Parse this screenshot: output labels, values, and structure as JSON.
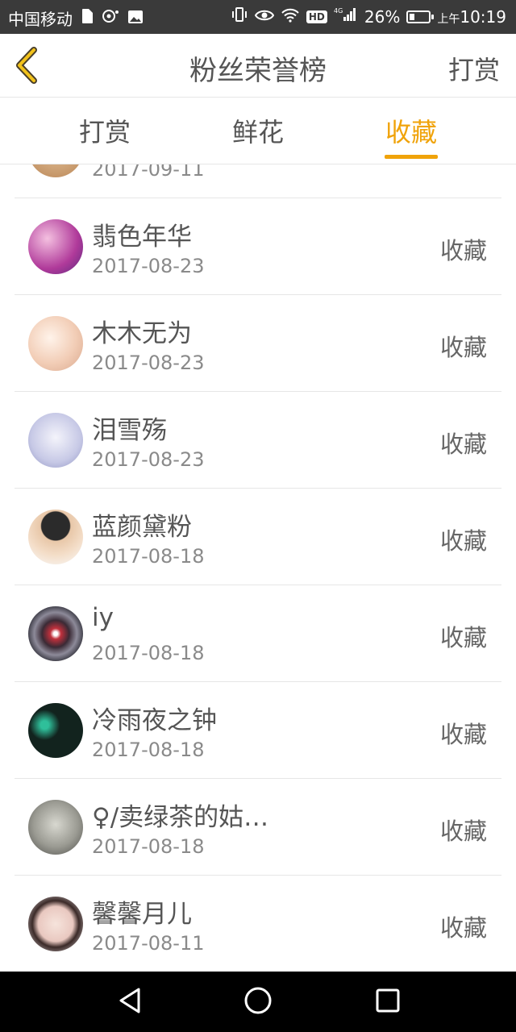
{
  "status_bar": {
    "carrier": "中国移动",
    "network": "4G",
    "hd_label": "HD",
    "battery_percent": "26%",
    "battery_level": 0.26,
    "time_prefix": "上午",
    "time": "10:19"
  },
  "header": {
    "title": "粉丝荣誉榜",
    "right_action": "打赏",
    "back_icon": "chevron-left-icon"
  },
  "tabs": [
    {
      "label": "打赏",
      "active": false
    },
    {
      "label": "鲜花",
      "active": false
    },
    {
      "label": "收藏",
      "active": true
    }
  ],
  "accent_color": "#f0a30a",
  "list": {
    "partial_first_date": "2017-09-11",
    "items": [
      {
        "name": "翡色年华",
        "date": "2017-08-23",
        "action": "收藏"
      },
      {
        "name": "木木无为",
        "date": "2017-08-23",
        "action": "收藏"
      },
      {
        "name": "泪雪殇",
        "date": "2017-08-23",
        "action": "收藏"
      },
      {
        "name": "蓝颜黛粉",
        "date": "2017-08-18",
        "action": "收藏"
      },
      {
        "name": "iy",
        "date": "2017-08-18",
        "action": "收藏"
      },
      {
        "name": "冷雨夜之钟",
        "date": "2017-08-18",
        "action": "收藏"
      },
      {
        "name": "♀/卖绿茶的姑…",
        "date": "2017-08-18",
        "action": "收藏"
      },
      {
        "name": "馨馨月儿",
        "date": "2017-08-11",
        "action": "收藏"
      }
    ]
  },
  "nav_bar": {
    "icons": [
      "back-triangle-icon",
      "home-circle-icon",
      "recent-square-icon"
    ]
  }
}
